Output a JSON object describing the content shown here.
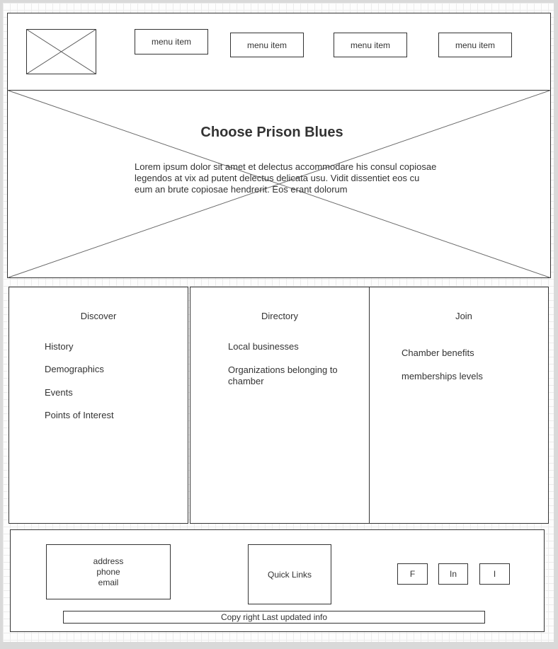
{
  "header": {
    "logo_icon": "image-placeholder-icon",
    "menu": [
      {
        "label": "menu item"
      },
      {
        "label": "menu item"
      },
      {
        "label": "menu item"
      },
      {
        "label": "menu item"
      }
    ]
  },
  "hero": {
    "title": "Choose Prison Blues",
    "body": "Lorem ipsum dolor sit amet et delectus accommodare his consul copiosae legendos at vix ad putent delectus delicata usu. Vidit dissentiet eos cu eum an brute copiosae hendrerit. Eos erant dolorum",
    "background_icon": "image-placeholder-icon"
  },
  "columns": [
    {
      "heading": "Discover",
      "links": [
        "History",
        "Demographics",
        "Events",
        "Points of Interest"
      ]
    },
    {
      "heading": "Directory",
      "links": [
        "Local businesses",
        "Organizations belonging to chamber"
      ]
    },
    {
      "heading": "Join",
      "links": [
        "Chamber benefits",
        "memberships levels"
      ]
    }
  ],
  "footer": {
    "contact": [
      "address",
      "phone",
      "email"
    ],
    "quick_links": "Quick Links",
    "social": [
      "F",
      "In",
      "I"
    ],
    "copyright": "Copy right Last updated info"
  }
}
